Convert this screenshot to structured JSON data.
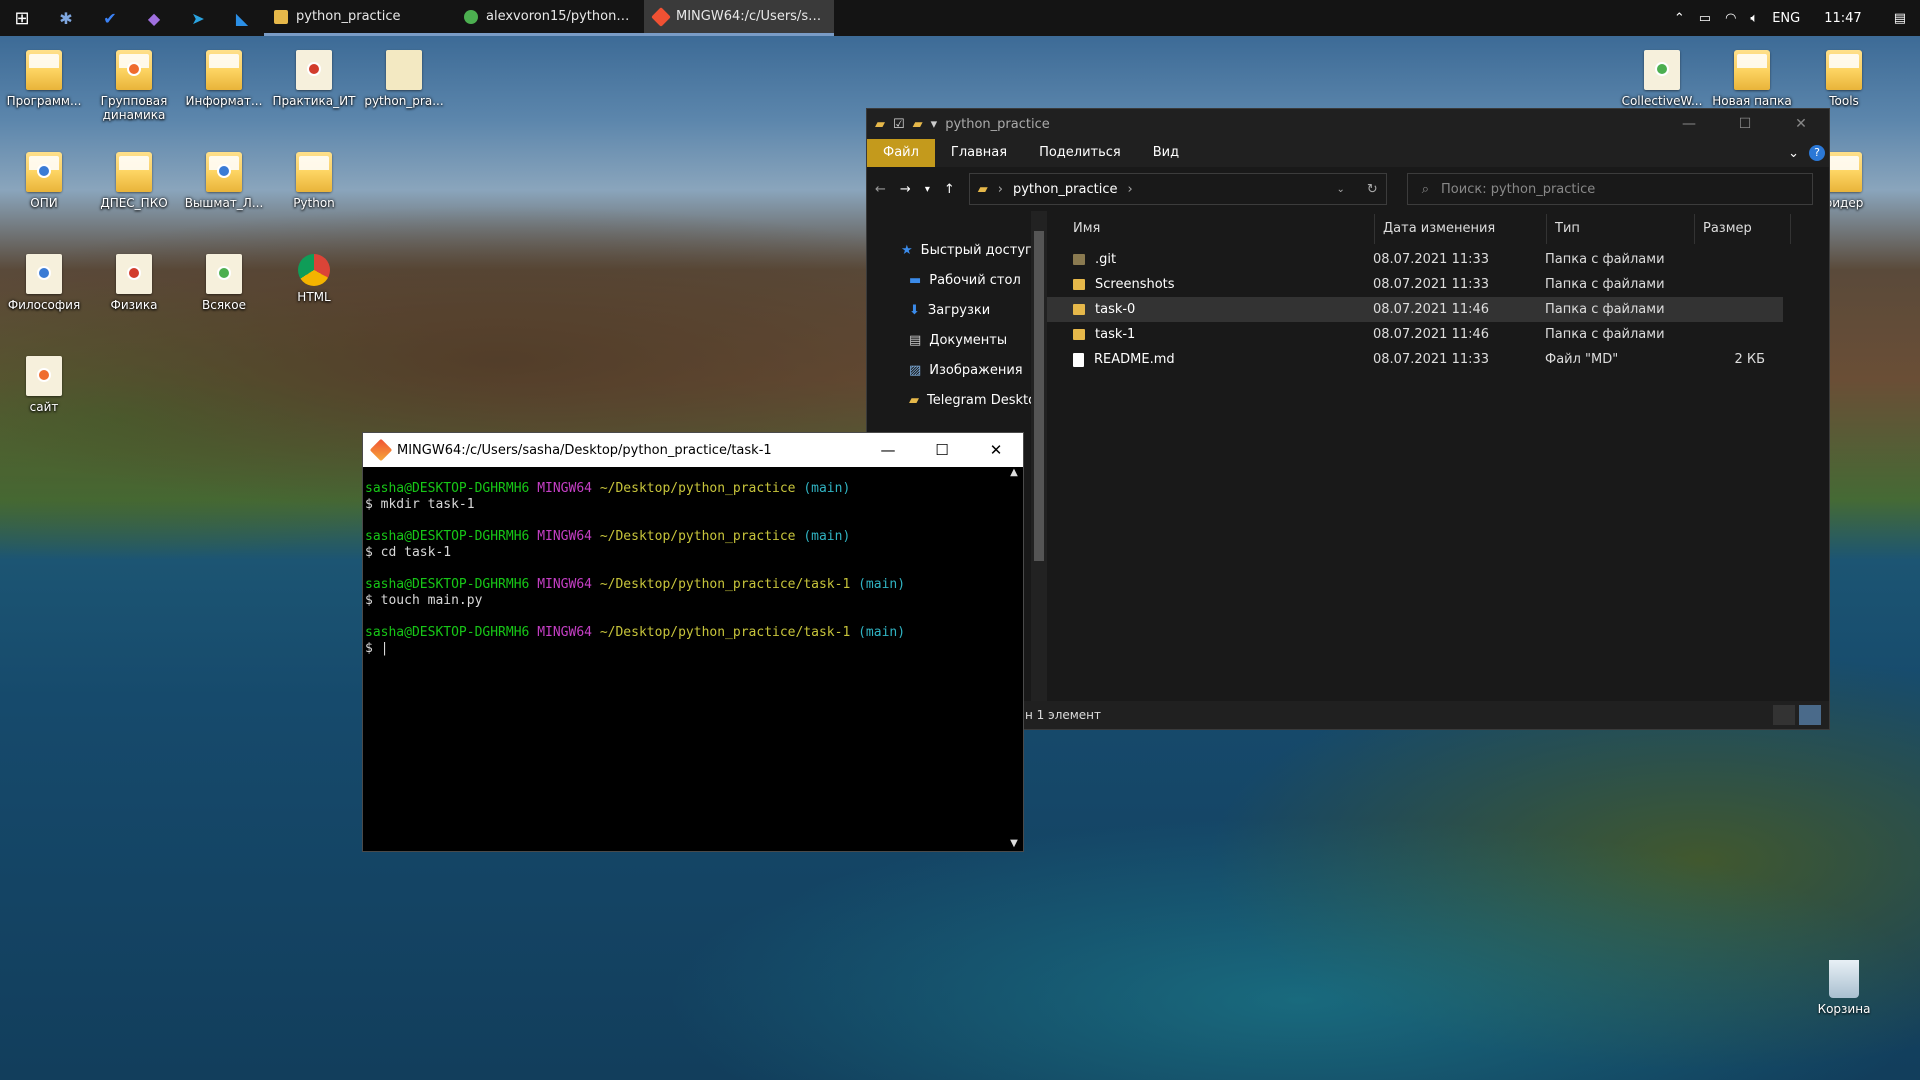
{
  "taskbar": {
    "tasks": [
      {
        "label": "python_practice",
        "icon": "folder-icon",
        "color": "#e6b84a"
      },
      {
        "label": "alexvoron15/python_p...",
        "icon": "chrome-icon",
        "color": "#4caf50"
      },
      {
        "label": "MINGW64:/c/Users/sa...",
        "icon": "git-icon",
        "color": "#f05133"
      }
    ],
    "tray": {
      "language": "ENG",
      "time": "11:47"
    }
  },
  "desktop_icons": [
    {
      "label": "Программ..."
    },
    {
      "label": "Групповая\nдинамика"
    },
    {
      "label": "Информат..."
    },
    {
      "label": "Практика_ИТ"
    },
    {
      "label": "python_pra..."
    },
    {
      "label": "ОПИ"
    },
    {
      "label": "ДПЕС_ПКО"
    },
    {
      "label": "Вышмат_Л..."
    },
    {
      "label": "Python"
    },
    {
      "label": "Философия"
    },
    {
      "label": "Физика"
    },
    {
      "label": "Всякое"
    },
    {
      "label": "HTML"
    },
    {
      "label": "сайт"
    },
    {
      "label": "CollectiveW..."
    },
    {
      "label": "Новая папка"
    },
    {
      "label": "Tools"
    },
    {
      "label": "ридер"
    }
  ],
  "recycle_bin": {
    "label": "Корзина"
  },
  "explorer": {
    "title": "python_practice",
    "ribbon": {
      "file": "Файл",
      "home": "Главная",
      "share": "Поделиться",
      "view": "Вид"
    },
    "address": "python_practice",
    "search_placeholder": "Поиск: python_practice",
    "columns": {
      "name": "Имя",
      "date": "Дата изменения",
      "type": "Тип",
      "size": "Размер"
    },
    "nav": [
      {
        "label": "Быстрый доступ"
      },
      {
        "label": "Рабочий стол"
      },
      {
        "label": "Загрузки"
      },
      {
        "label": "Документы"
      },
      {
        "label": "Изображения"
      },
      {
        "label": "Telegram Deskto"
      }
    ],
    "files": [
      {
        "name": ".git",
        "date": "08.07.2021 11:33",
        "type": "Папка с файлами",
        "size": ""
      },
      {
        "name": "Screenshots",
        "date": "08.07.2021 11:33",
        "type": "Папка с файлами",
        "size": ""
      },
      {
        "name": "task-0",
        "date": "08.07.2021 11:46",
        "type": "Папка с файлами",
        "size": ""
      },
      {
        "name": "task-1",
        "date": "08.07.2021 11:46",
        "type": "Папка с файлами",
        "size": ""
      },
      {
        "name": "README.md",
        "date": "08.07.2021 11:33",
        "type": "Файл \"MD\"",
        "size": "2 КБ"
      }
    ],
    "status": "н 1 элемент"
  },
  "terminal": {
    "title": "MINGW64:/c/Users/sasha/Desktop/python_practice/task-1",
    "lines": [
      {
        "user": "sasha@DESKTOP-DGHRMH6",
        "sys": "MINGW64",
        "path": "~/Desktop/python_practice",
        "branch": "(main)",
        "cmd": "$ mkdir task-1"
      },
      {
        "user": "sasha@DESKTOP-DGHRMH6",
        "sys": "MINGW64",
        "path": "~/Desktop/python_practice",
        "branch": "(main)",
        "cmd": "$ cd task-1"
      },
      {
        "user": "sasha@DESKTOP-DGHRMH6",
        "sys": "MINGW64",
        "path": "~/Desktop/python_practice/task-1",
        "branch": "(main)",
        "cmd": "$ touch main.py"
      },
      {
        "user": "sasha@DESKTOP-DGHRMH6",
        "sys": "MINGW64",
        "path": "~/Desktop/python_practice/task-1",
        "branch": "(main)",
        "cmd": "$ |"
      }
    ]
  }
}
